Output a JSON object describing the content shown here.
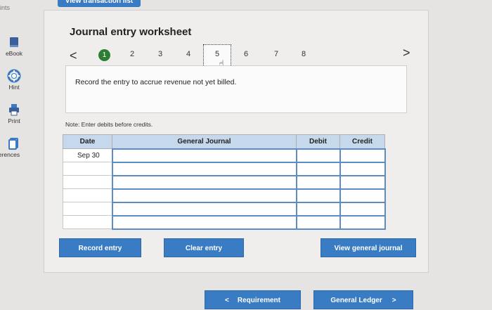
{
  "header": {
    "tab_label": "ints",
    "view_button": "View transaction list"
  },
  "sidebar": {
    "items": [
      {
        "label": "eBook",
        "icon": "book-icon"
      },
      {
        "label": "Hint",
        "icon": "lifebuoy-icon"
      },
      {
        "label": "Print",
        "icon": "printer-icon"
      },
      {
        "label": "erences",
        "icon": "references-icon"
      }
    ]
  },
  "worksheet": {
    "title": "Journal entry worksheet",
    "pages": [
      "1",
      "2",
      "3",
      "4",
      "5",
      "6",
      "7",
      "8"
    ],
    "active_page": "1",
    "current_page": "5",
    "prev": "<",
    "next": ">",
    "prompt": "Record the entry to accrue revenue not yet billed.",
    "note": "Note: Enter debits before credits."
  },
  "table": {
    "headers": [
      "Date",
      "General Journal",
      "Debit",
      "Credit"
    ],
    "rows": [
      {
        "date": "Sep 30",
        "account": "",
        "debit": "",
        "credit": ""
      },
      {
        "date": "",
        "account": "",
        "debit": "",
        "credit": ""
      },
      {
        "date": "",
        "account": "",
        "debit": "",
        "credit": ""
      },
      {
        "date": "",
        "account": "",
        "debit": "",
        "credit": ""
      },
      {
        "date": "",
        "account": "",
        "debit": "",
        "credit": ""
      },
      {
        "date": "",
        "account": "",
        "debit": "",
        "credit": ""
      }
    ]
  },
  "actions": {
    "record": "Record entry",
    "clear": "Clear entry",
    "view_ledger": "View general journal"
  },
  "footer": {
    "requirement": "Requirement",
    "requirement_chevron": "<",
    "general_ledger": "General Ledger",
    "ledger_chevron": ">"
  },
  "colors": {
    "button_blue": "#3a7cc4",
    "header_blue": "#c6d9ec",
    "active_green": "#2e7d32"
  }
}
